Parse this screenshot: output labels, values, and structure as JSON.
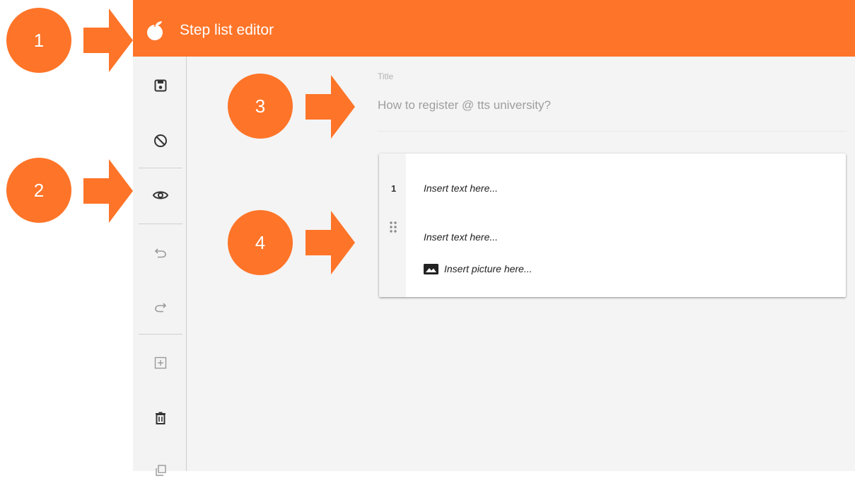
{
  "app": {
    "title": "Step list editor",
    "accent_color": "#fe7428",
    "logo_icon": "peach-logo-icon"
  },
  "sidebar": {
    "tools": [
      {
        "name": "save-icon",
        "enabled": true
      },
      {
        "name": "cancel-icon",
        "enabled": true
      },
      {
        "name": "preview-eye-icon",
        "enabled": true
      },
      {
        "name": "undo-icon",
        "enabled": false
      },
      {
        "name": "redo-icon",
        "enabled": false
      },
      {
        "name": "add-step-icon",
        "enabled": false
      },
      {
        "name": "delete-icon",
        "enabled": true
      },
      {
        "name": "duplicate-icon",
        "enabled": false
      }
    ]
  },
  "editor": {
    "title_label": "Title",
    "title_placeholder": "How to register @ tts university?",
    "steps": [
      {
        "number": "1",
        "text_placeholder_1": "Insert text here...",
        "text_placeholder_2": "Insert text here...",
        "picture_placeholder": "Insert picture here..."
      }
    ]
  },
  "callouts": [
    "1",
    "2",
    "3",
    "4"
  ]
}
